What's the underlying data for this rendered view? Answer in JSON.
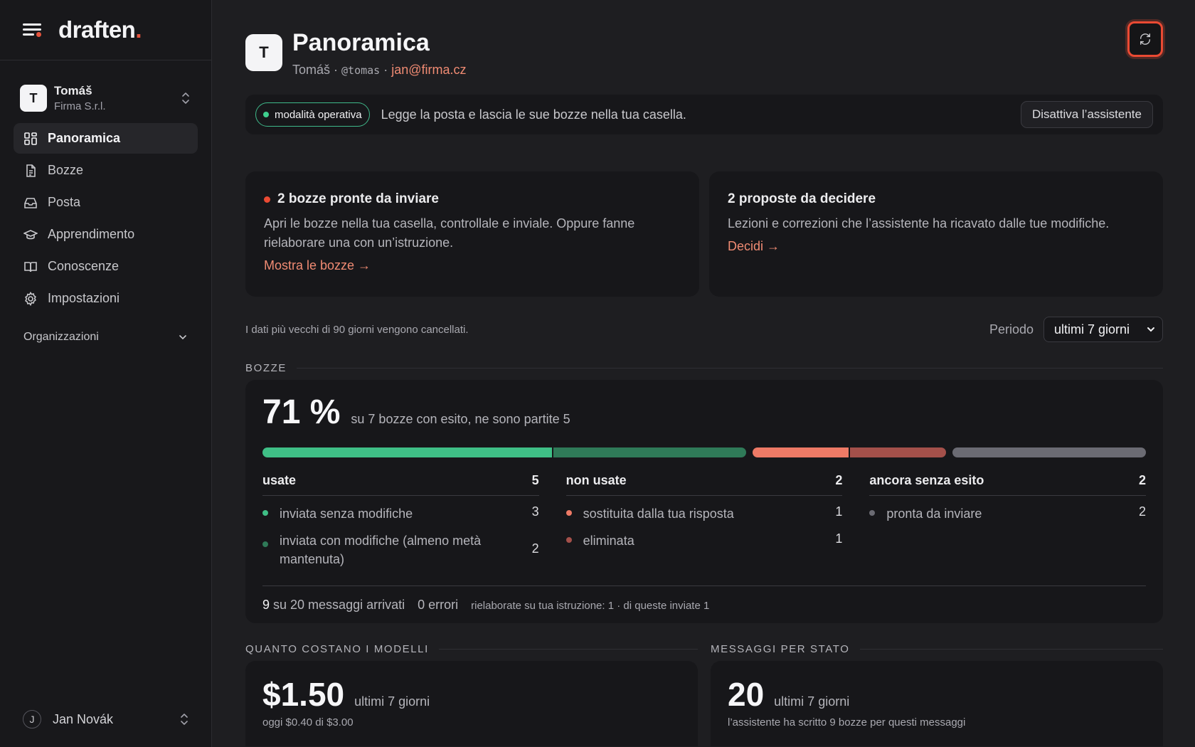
{
  "brand": {
    "name": "draften",
    "dot": "."
  },
  "account": {
    "initial": "T",
    "name": "Tomáš",
    "org": "Firma S.r.l."
  },
  "nav": [
    {
      "label": "Panoramica",
      "icon": "dashboard-icon",
      "active": true
    },
    {
      "label": "Bozze",
      "icon": "document-icon"
    },
    {
      "label": "Posta",
      "icon": "inbox-icon"
    },
    {
      "label": "Apprendimento",
      "icon": "graduation-cap-icon"
    },
    {
      "label": "Conoscenze",
      "icon": "book-icon"
    },
    {
      "label": "Impostazioni",
      "icon": "gear-icon"
    }
  ],
  "organizations": {
    "label": "Organizzazioni"
  },
  "user": {
    "initial": "J",
    "name": "Jan Novák"
  },
  "header": {
    "initial": "T",
    "title": "Panoramica",
    "name": "Tomáš",
    "separator": " · ",
    "handle": "@tomas",
    "email": "jan@firma.cz"
  },
  "mode": {
    "badge": "modalità operativa",
    "text": "Legge la posta e lascia le sue bozze nella tua casella.",
    "button": "Disattiva l’assistente"
  },
  "cards": [
    {
      "title": "2 bozze pronte da inviare",
      "desc": "Apri le bozze nella tua casella, controllale e inviale. Oppure fanne rielaborare una con un’istruzione.",
      "link": "Mostra le bozze →"
    },
    {
      "title": "2 proposte da decidere",
      "desc": "Lezioni e correzioni che l’assistente ha ricavato dalle tue modifiche.",
      "link": "Decidi →"
    }
  ],
  "retention": "I dati più vecchi di 90 giorni vengono cancellati.",
  "period": {
    "label": "Periodo",
    "value": "ultimi 7 giorni"
  },
  "bozze": {
    "section": "BOZZE",
    "big": "71 %",
    "sub": "su 7 bozze con esito, ne sono partite 5",
    "bar_groups": [
      [
        {
          "value": 3,
          "color": "#3fbf86"
        },
        {
          "value": 2,
          "color": "#2f7a58"
        }
      ],
      [
        {
          "value": 1,
          "color": "#ee7a66"
        },
        {
          "value": 1,
          "color": "#a4504a"
        }
      ],
      [
        {
          "value": 2,
          "color": "#6b6b73"
        }
      ]
    ],
    "columns": [
      {
        "label": "usate",
        "count": "5",
        "rows": [
          {
            "label": "inviata senza modifiche",
            "count": "3",
            "color": "#3fbf86"
          },
          {
            "label": "inviata con modifiche (almeno metà mantenuta)",
            "count": "2",
            "color": "#2f7a58"
          }
        ]
      },
      {
        "label": "non usate",
        "count": "2",
        "rows": [
          {
            "label": "sostituita dalla tua risposta",
            "count": "1",
            "color": "#ee7a66"
          },
          {
            "label": "eliminata",
            "count": "1",
            "color": "#a4504a"
          }
        ]
      },
      {
        "label": "ancora senza esito",
        "count": "2",
        "rows": [
          {
            "label": "pronta da inviare",
            "count": "2",
            "color": "#6b6b73"
          }
        ]
      }
    ],
    "footer": {
      "arrived_num": "9",
      "arrived_text": " su 20 messaggi arrivati",
      "errors": "0 errori",
      "reworked": "rielaborate su tua istruzione: 1 · di queste inviate 1"
    }
  },
  "costs": {
    "section": "QUANTO COSTANO I MODELLI",
    "value": "$1.50",
    "period": "ultimi 7 giorni",
    "note": "oggi $0.40 di $3.00"
  },
  "messages": {
    "section": "MESSAGGI PER STATO",
    "value": "20",
    "period": "ultimi 7 giorni",
    "note": "l’assistente ha scritto 9 bozze per questi messaggi"
  }
}
